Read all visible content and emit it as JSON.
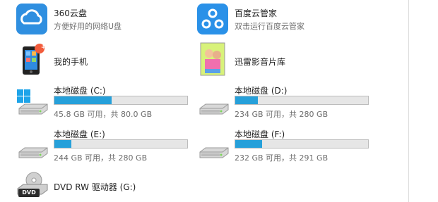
{
  "apps": [
    {
      "title": "360云盘",
      "subtitle": "方便好用的网络U盘"
    },
    {
      "title": "百度云管家",
      "subtitle": "双击运行百度云管家"
    },
    {
      "title": "我的手机"
    },
    {
      "title": "迅雷影音片库"
    }
  ],
  "phone_badge": "49",
  "drives": [
    {
      "label": "本地磁盘 (C:)",
      "info": "45.8 GB 可用，共 80.0 GB",
      "used_fraction": 0.43
    },
    {
      "label": "本地磁盘 (D:)",
      "info": "234 GB 可用，共 280 GB",
      "used_fraction": 0.17
    },
    {
      "label": "本地磁盘 (E:)",
      "info": "244 GB 可用，共 280 GB",
      "used_fraction": 0.13
    },
    {
      "label": "本地磁盘 (F:)",
      "info": "232 GB 可用，共 291 GB",
      "used_fraction": 0.2
    }
  ],
  "dvd": {
    "label": "DVD RW 驱动器 (G:)",
    "badge": "DVD"
  },
  "colors": {
    "accent": "#26a0da",
    "bar_bg": "#e6e6e6"
  }
}
